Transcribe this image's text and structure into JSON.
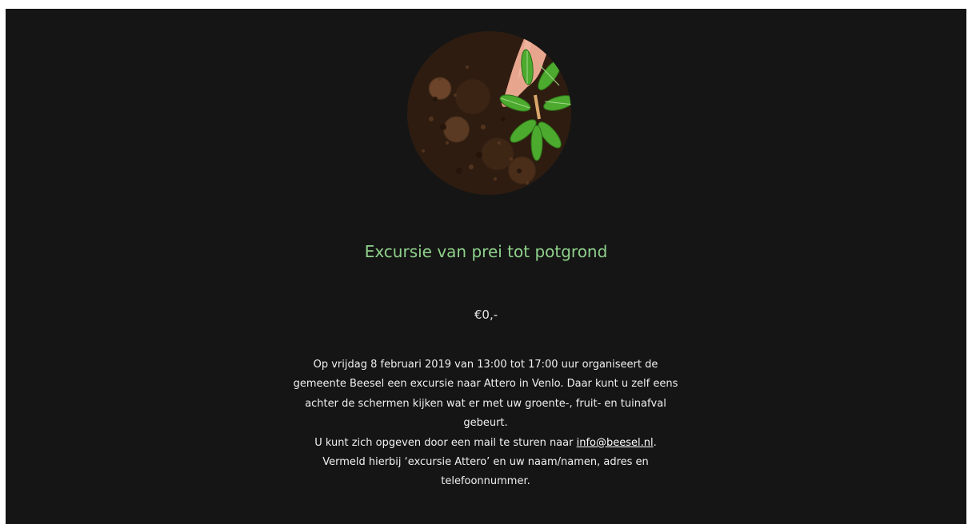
{
  "product": {
    "title": "Excursie van prei tot potgrond",
    "price": "€0,-",
    "image_icon": "soil-seedling-image",
    "description_part1": "Op vrijdag 8 februari 2019 van 13:00 tot 17:00 uur organiseert de gemeente Beesel een excursie naar Attero in Venlo. Daar kunt u zelf eens achter de schermen kijken wat er met uw groente-, fruit- en tuinafval gebeurt.",
    "description_part2": "U kunt zich opgeven door een mail te sturen naar",
    "email_link": "info@beesel.nl",
    "description_part3": ".",
    "description_part4": "Vermeld hierbij ‘excursie Attero’ en uw naam/namen, adres en telefoonnummer."
  },
  "colors": {
    "background": "#151515",
    "title": "#8fd18b",
    "text": "#f0f0f0"
  }
}
